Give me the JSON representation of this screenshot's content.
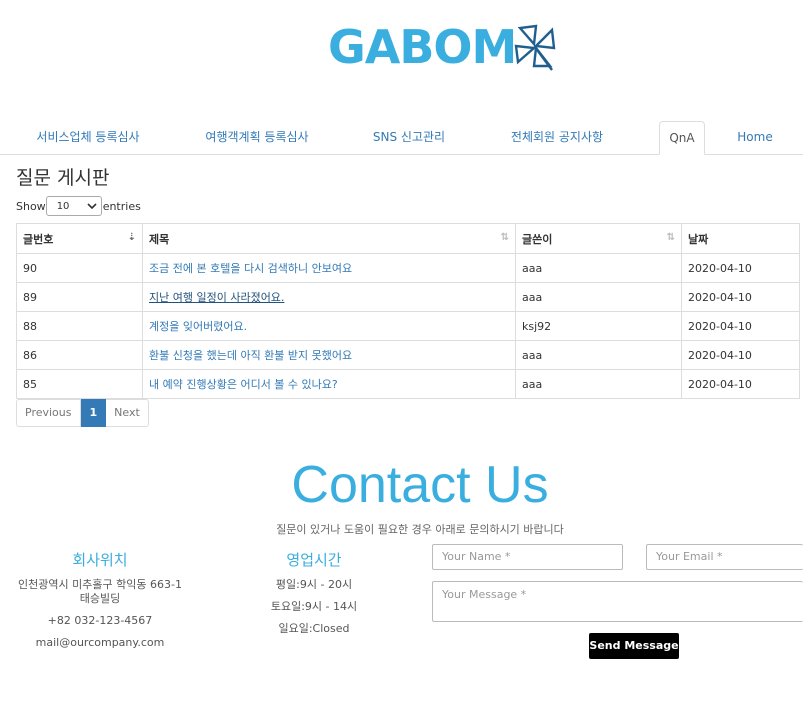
{
  "logo": {
    "text": "GABOM",
    "icon": "pinwheel-icon"
  },
  "tabs": [
    {
      "label": "서비스업체 등록심사"
    },
    {
      "label": "여행객계획 등록심사"
    },
    {
      "label": "SNS 신고관리"
    },
    {
      "label": "전체회원 공지사항"
    },
    {
      "label": "QnA",
      "active": true
    },
    {
      "label": "Home"
    }
  ],
  "board": {
    "title": "질문 게시판",
    "show_label": "Show",
    "entries_label": "entries",
    "page_length": "10",
    "columns": [
      "글번호",
      "제목",
      "글쓴이",
      "날짜"
    ],
    "rows": [
      {
        "no": "90",
        "title": "조금 전에 본 호텔을 다시 검색하니 안보여요",
        "author": "aaa",
        "date": "2020-04-10"
      },
      {
        "no": "89",
        "title": "지난 여행 일정이 사라졌어요.",
        "author": "aaa",
        "date": "2020-04-10"
      },
      {
        "no": "88",
        "title": "계정을 잊어버렸어요.",
        "author": "ksj92",
        "date": "2020-04-10"
      },
      {
        "no": "86",
        "title": "환불 신청을 했는데 아직 환불 받지 못했어요",
        "author": "aaa",
        "date": "2020-04-10"
      },
      {
        "no": "85",
        "title": "내 예약 진행상황은 어디서 볼 수 있나요?",
        "author": "aaa",
        "date": "2020-04-10"
      }
    ],
    "pager": {
      "prev": "Previous",
      "current": "1",
      "next": "Next"
    }
  },
  "contact": {
    "title": "Contact Us",
    "subtitle": "질문이 있거나 도움이 필요한 경우 아래로 문의하시기 바랍니다",
    "location": {
      "heading": "회사위치",
      "address": "인천광역시 미추홀구 학익동 663-1 태승빌딩",
      "phone": "+82 032-123-4567",
      "email": "mail@ourcompany.com"
    },
    "hours": {
      "heading": "영업시간",
      "weekday": "평일:9시 - 20시",
      "saturday": "토요일:9시 - 14시",
      "sunday": "일요일:Closed"
    },
    "form": {
      "name_placeholder": "Your Name *",
      "email_placeholder": "Your Email *",
      "message_placeholder": "Your Message *",
      "send_label": "Send Message"
    }
  },
  "colors": {
    "brand": "#3aaedf",
    "link": "#337ab7",
    "pager_active": "#337ab7",
    "send_button": "#000000"
  }
}
